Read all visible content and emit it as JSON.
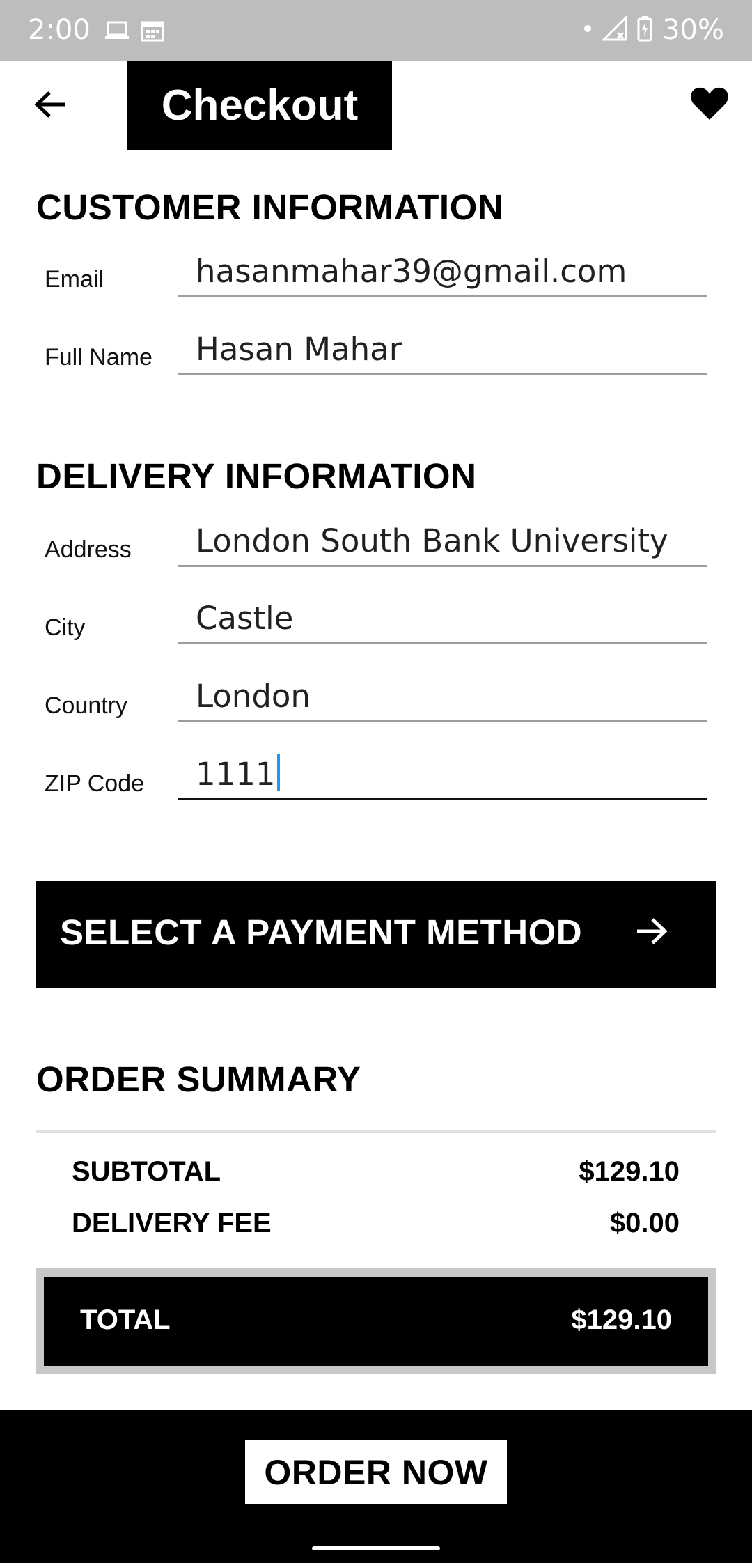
{
  "status_bar": {
    "time": "2:00",
    "battery_percent": "30%",
    "icons": [
      "laptop-icon",
      "calendar-icon",
      "dot-icon",
      "signal-icon",
      "battery-charging-icon"
    ]
  },
  "app_bar": {
    "title": "Checkout",
    "back_icon": "arrow-left-icon",
    "favorite_icon": "heart-icon"
  },
  "customer_info": {
    "heading": "CUSTOMER INFORMATION",
    "fields": [
      {
        "label": "Email",
        "value": "hasanmahar39@gmail.com"
      },
      {
        "label": "Full Name",
        "value": "Hasan Mahar"
      }
    ]
  },
  "delivery_info": {
    "heading": "DELIVERY INFORMATION",
    "fields": [
      {
        "label": "Address",
        "value": "London South Bank University"
      },
      {
        "label": "City",
        "value": "Castle"
      },
      {
        "label": "Country",
        "value": "London"
      },
      {
        "label": "ZIP Code",
        "value": "1111"
      }
    ]
  },
  "payment": {
    "label": "SELECT A PAYMENT METHOD",
    "icon": "arrow-right-icon"
  },
  "order_summary": {
    "heading": "ORDER SUMMARY",
    "subtotal_label": "SUBTOTAL",
    "subtotal_value": "$129.10",
    "delivery_label": "DELIVERY FEE",
    "delivery_value": "$0.00",
    "total_label": "TOTAL",
    "total_value": "$129.10"
  },
  "bottom": {
    "order_label": "ORDER NOW"
  },
  "colors": {
    "status_bar": "#bdbdbd",
    "primary": "#000000",
    "cursor": "#2196f3"
  }
}
